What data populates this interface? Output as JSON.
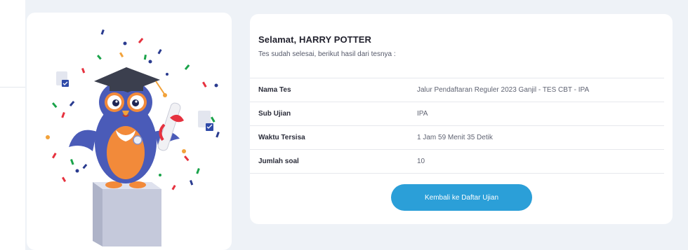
{
  "result": {
    "greeting": "Selamat, HARRY POTTER",
    "subtitle": "Tes sudah selesai, berikut hasil dari tesnya :",
    "rows": [
      {
        "label": "Nama Tes",
        "value": "Jalur Pendaftaran Reguler 2023 Ganjil - TES CBT - IPA"
      },
      {
        "label": "Sub Ujian",
        "value": "IPA"
      },
      {
        "label": "Waktu Tersisa",
        "value": "1 Jam 59 Menit 35 Detik"
      },
      {
        "label": "Jumlah soal",
        "value": "10"
      }
    ],
    "back_button_label": "Kembali ke Daftar Ujian"
  },
  "colors": {
    "accent": "#2b9fd8",
    "owl_body": "#4a5bb8",
    "owl_belly": "#f28a3a",
    "podium": "#c5c9db"
  },
  "illustration": {
    "icon": "graduate-owl-celebration-illustration"
  }
}
